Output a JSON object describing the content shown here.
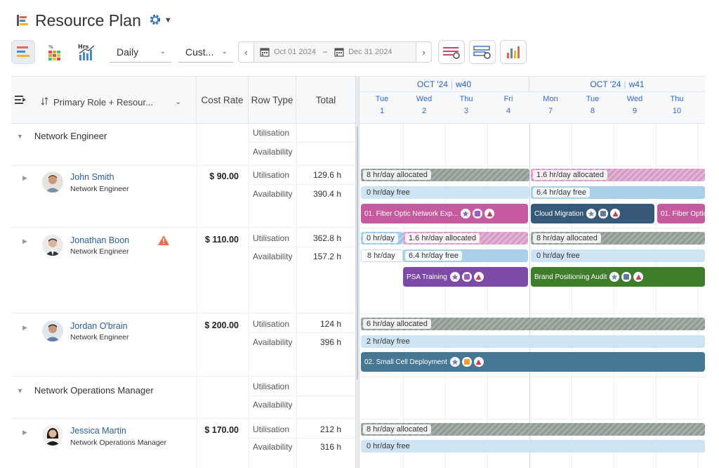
{
  "title": "Resource Plan",
  "toolbar": {
    "scale": "Daily",
    "custom": "Cust...",
    "start_date": "Oct 01 2024",
    "end_date": "Dec 31 2024",
    "pct_label": "%",
    "hrs_label": "Hrs"
  },
  "columns": {
    "group_by": "Primary Role + Resour...",
    "cost_rate": "Cost Rate",
    "row_type": "Row Type",
    "total": "Total"
  },
  "timeline": {
    "weeks": [
      {
        "month": "OCT '24",
        "week": "w40"
      },
      {
        "month": "OCT '24",
        "week": "w41"
      }
    ],
    "days": [
      {
        "dow": "Tue",
        "num": "1"
      },
      {
        "dow": "Wed",
        "num": "2"
      },
      {
        "dow": "Thu",
        "num": "3"
      },
      {
        "dow": "Fri",
        "num": "4"
      },
      {
        "dow": "Mon",
        "num": "7"
      },
      {
        "dow": "Tue",
        "num": "8"
      },
      {
        "dow": "Wed",
        "num": "9"
      },
      {
        "dow": "Thu",
        "num": "10"
      }
    ]
  },
  "row_types": {
    "util": "Utilisation",
    "avail": "Availability"
  },
  "groups": [
    {
      "name": "Network Engineer"
    },
    {
      "name": "Network Operations Manager"
    }
  ],
  "people": [
    {
      "name": "John Smith",
      "role": "Network Engineer",
      "rate": "$ 90.00",
      "util": "129.6 h",
      "avail": "390.4 h"
    },
    {
      "name": "Jonathan Boon",
      "role": "Network Engineer",
      "rate": "$ 110.00",
      "util": "362.8 h",
      "avail": "157.2 h"
    },
    {
      "name": "Jordan O'brain",
      "role": "Network Engineer",
      "rate": "$ 200.00",
      "util": "124 h",
      "avail": "396 h"
    },
    {
      "name": "Jessica Martin",
      "role": "Network Operations Manager",
      "rate": "$ 170.00",
      "util": "212 h",
      "avail": "316 h"
    }
  ],
  "bars": {
    "js_alloc_1": "8 hr/day allocated",
    "js_alloc_2": "1.6 hr/day allocated",
    "js_free_1": "0 hr/day free",
    "js_free_2": "6.4 hr/day free",
    "jb_alloc_1": "0 hr/day",
    "jb_alloc_2": "1.6 hr/day allocated",
    "jb_alloc_3": "8 hr/day allocated",
    "jb_free_1": "8 hr/day",
    "jb_free_2": "6.4 hr/day free",
    "jb_free_3": "0 hr/day free",
    "jo_alloc": "6 hr/day allocated",
    "jo_free": "2 hr/day free",
    "jm_alloc": "8 hr/day allocated",
    "jm_free": "0 hr/day free"
  },
  "tasks": {
    "t1": "01. Fiber Optic Network Exp...",
    "t2": "Cloud Migration",
    "t3": "01. Fiber Optic",
    "t4": "PSA Training",
    "t5": "Brand Positioning Audit",
    "t6": "02. Small Cell Deployment"
  },
  "colors": {
    "pink_task": "#c55a9e",
    "navy_task": "#36597a",
    "purple_task": "#7e4aa8",
    "green_task": "#3e7d2a",
    "teal_task": "#467795",
    "link": "#2a5d9a"
  }
}
